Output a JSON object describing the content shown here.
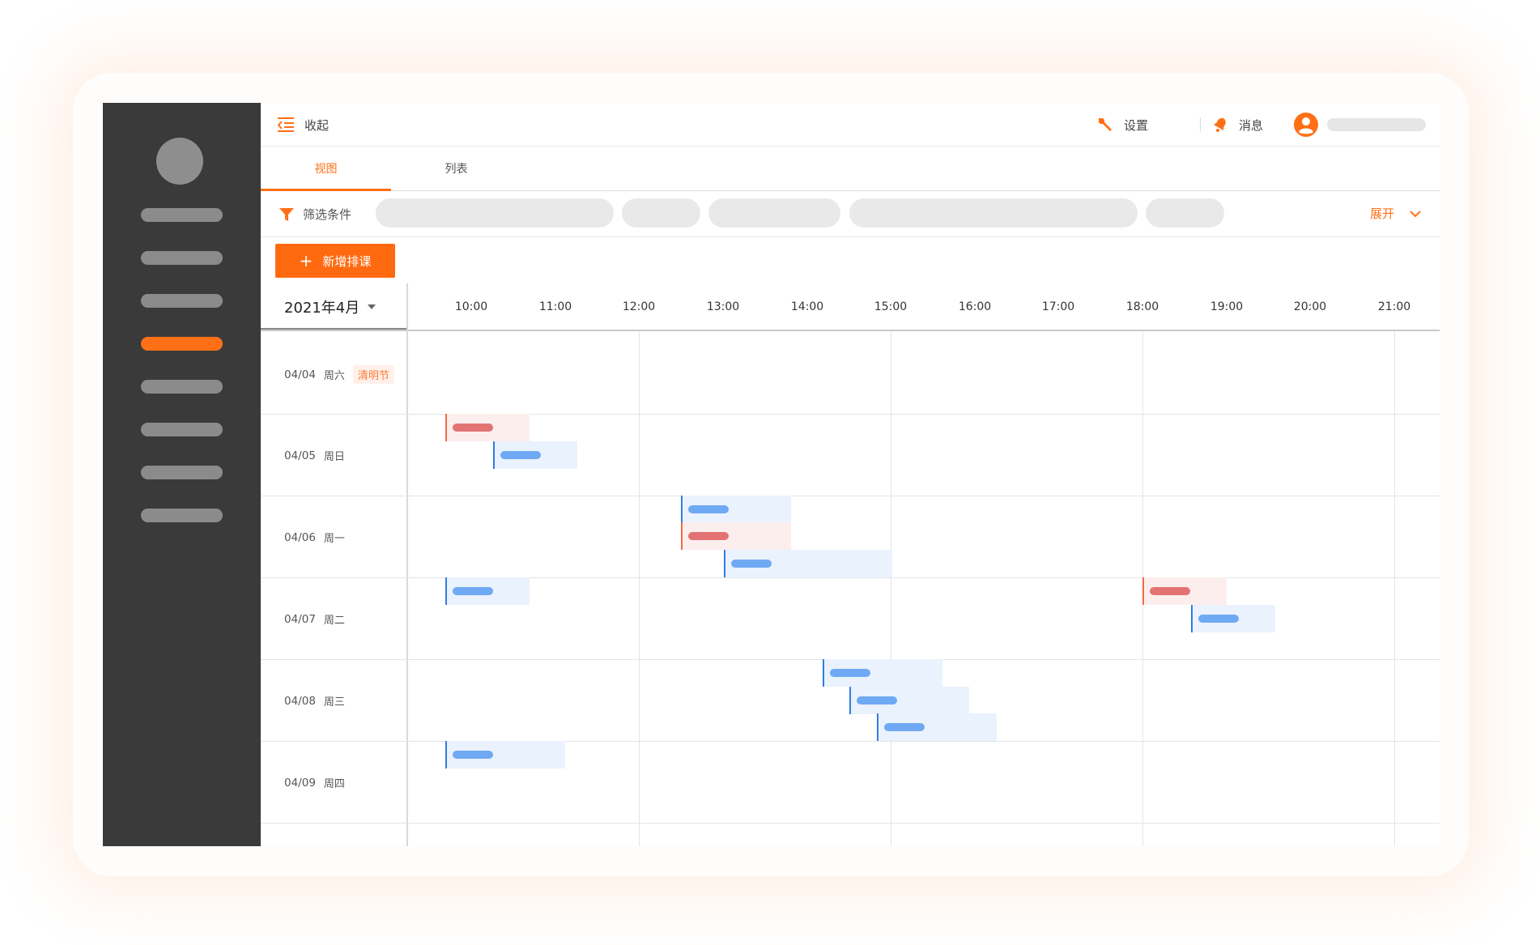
{
  "topbar": {
    "collapse_label": "收起",
    "settings_label": "设置",
    "messages_label": "消息"
  },
  "tabs": [
    {
      "label": "视图",
      "active": true
    },
    {
      "label": "列表",
      "active": false
    }
  ],
  "filter": {
    "label": "筛选条件",
    "expand_label": "展开"
  },
  "add_button": {
    "label": "新增排课"
  },
  "calendar": {
    "month": "2021年4月",
    "times": [
      "10:00",
      "11:00",
      "12:00",
      "13:00",
      "14:00",
      "15:00",
      "16:00",
      "17:00",
      "18:00",
      "19:00",
      "20:00",
      "21:00"
    ],
    "days": [
      {
        "date": "04/04",
        "weekday": "周六",
        "holiday": "清明节"
      },
      {
        "date": "04/05",
        "weekday": "周日"
      },
      {
        "date": "04/06",
        "weekday": "周一"
      },
      {
        "date": "04/07",
        "weekday": "周二"
      },
      {
        "date": "04/08",
        "weekday": "周三"
      },
      {
        "date": "04/09",
        "weekday": "周四"
      }
    ]
  },
  "colors": {
    "accent": "#ff7016",
    "sidebar_bg": "#3a3a3a",
    "event_blue": "#2f7de1",
    "event_red": "#ef6b47"
  },
  "icons": {
    "collapse": "collapse-menu-icon",
    "settings": "wrench-icon",
    "messages": "bell-icon",
    "user": "user-avatar-icon",
    "filter": "filter-funnel-icon",
    "expand": "chevron-down-icon",
    "month_select": "caret-down-icon"
  }
}
